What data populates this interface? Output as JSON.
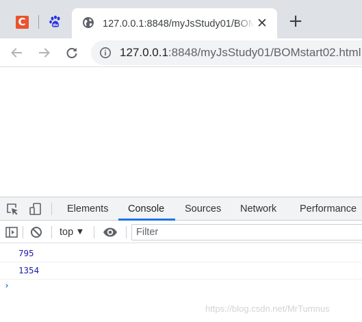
{
  "browser": {
    "pinned_tabs": [
      {
        "name": "csdn",
        "icon": "csdn-icon",
        "letter": "C",
        "color": "#e9532f"
      },
      {
        "name": "baidu",
        "icon": "baidu-paw-icon",
        "color": "#2932e1"
      }
    ],
    "active_tab": {
      "title": "127.0.0.1:8848/myJsStudy01/BOMstart02.html",
      "icon": "globe-icon",
      "close_glyph": "✕"
    },
    "new_tab_glyph": "+",
    "address_bar": {
      "host": "127.0.0.1",
      "rest": ":8848/myJsStudy01/BOMstart02.html",
      "icon": "info-icon"
    }
  },
  "devtools": {
    "tabs": [
      {
        "label": "Elements",
        "active": false
      },
      {
        "label": "Console",
        "active": true
      },
      {
        "label": "Sources",
        "active": false
      },
      {
        "label": "Network",
        "active": false
      },
      {
        "label": "Performance",
        "active": false
      }
    ],
    "console_toolbar": {
      "context": "top",
      "context_caret": "▼",
      "filter_placeholder": "Filter"
    },
    "console_logs": [
      "795",
      "1354"
    ],
    "prompt_glyph": "›",
    "accent_color": "#1a73e8"
  },
  "watermark": "https://blog.csdn.net/MrTumnus"
}
